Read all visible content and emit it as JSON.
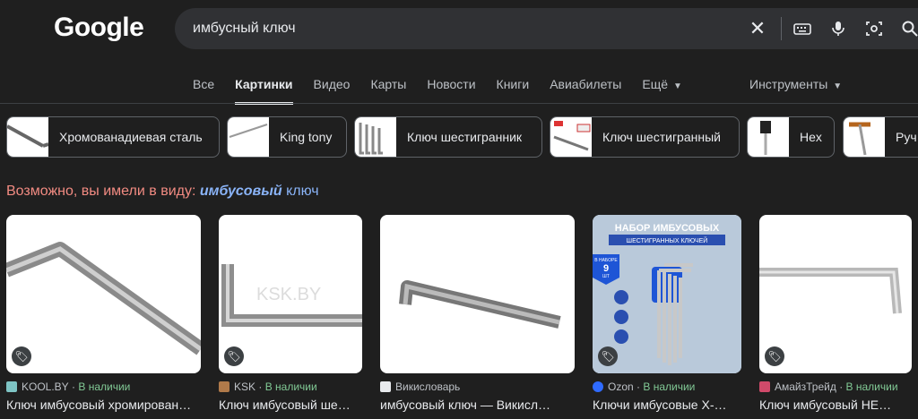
{
  "header": {
    "logo": "Google",
    "query": "имбусный ключ"
  },
  "tabs": [
    {
      "label": "Все"
    },
    {
      "label": "Картинки"
    },
    {
      "label": "Видео"
    },
    {
      "label": "Карты"
    },
    {
      "label": "Новости"
    },
    {
      "label": "Книги"
    },
    {
      "label": "Авиабилеты"
    },
    {
      "label": "Ещё"
    }
  ],
  "tools_label": "Инструменты",
  "chips": [
    {
      "label": "Хромованадиевая сталь"
    },
    {
      "label": "King tony"
    },
    {
      "label": "Ключ шестигранник"
    },
    {
      "label": "Ключ шестигранный"
    },
    {
      "label": "Hex"
    },
    {
      "label": "Руч"
    }
  ],
  "suggestion": {
    "prefix": "Возможно, вы имели в виду:",
    "corrected_word": "имбусовый",
    "rest": "ключ"
  },
  "results": [
    {
      "source": "KOOL.BY",
      "availability": "В наличии",
      "title": "Ключ имбусовый хромирован…",
      "favicon_color": "#7ec4c4"
    },
    {
      "source": "KSK",
      "availability": "В наличии",
      "title": "Ключ имбусовый ше…",
      "favicon_color": "#b07a4a"
    },
    {
      "source": "Викисловарь",
      "availability": "",
      "title": "имбусовый ключ — Викисл…",
      "favicon_color": "#e8eaed"
    },
    {
      "source": "Ozon",
      "availability": "В наличии",
      "title": "Ключи имбусовые Х-…",
      "favicon_color": "#2f6bff"
    },
    {
      "source": "АмайзТрейд",
      "availability": "В наличии",
      "title": "Ключ имбусовый НЕ…",
      "favicon_color": "#d04a6a"
    }
  ],
  "ozon_banner": {
    "line1": "НАБОР ИМБУСОВЫХ",
    "line2": "ШЕСТИГРАННЫХ КЛЮЧЕЙ",
    "badge1": "В НАБОРЕ",
    "badge2": "9",
    "badge3": "ШТ"
  },
  "watermark": "KSK.BY",
  "separator": "·"
}
